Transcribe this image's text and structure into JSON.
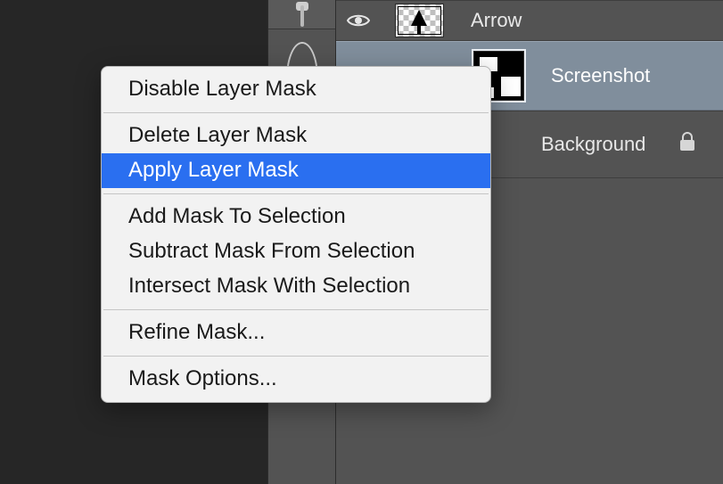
{
  "layers": {
    "arrow": {
      "name": "Arrow"
    },
    "screenshot": {
      "name": "Screenshot"
    },
    "background": {
      "name": "Background"
    }
  },
  "context_menu": {
    "items": [
      "Disable Layer Mask",
      "Delete Layer Mask",
      "Apply Layer Mask",
      "Add Mask To Selection",
      "Subtract Mask From Selection",
      "Intersect Mask With Selection",
      "Refine Mask...",
      "Mask Options..."
    ],
    "highlighted_index": 2
  }
}
